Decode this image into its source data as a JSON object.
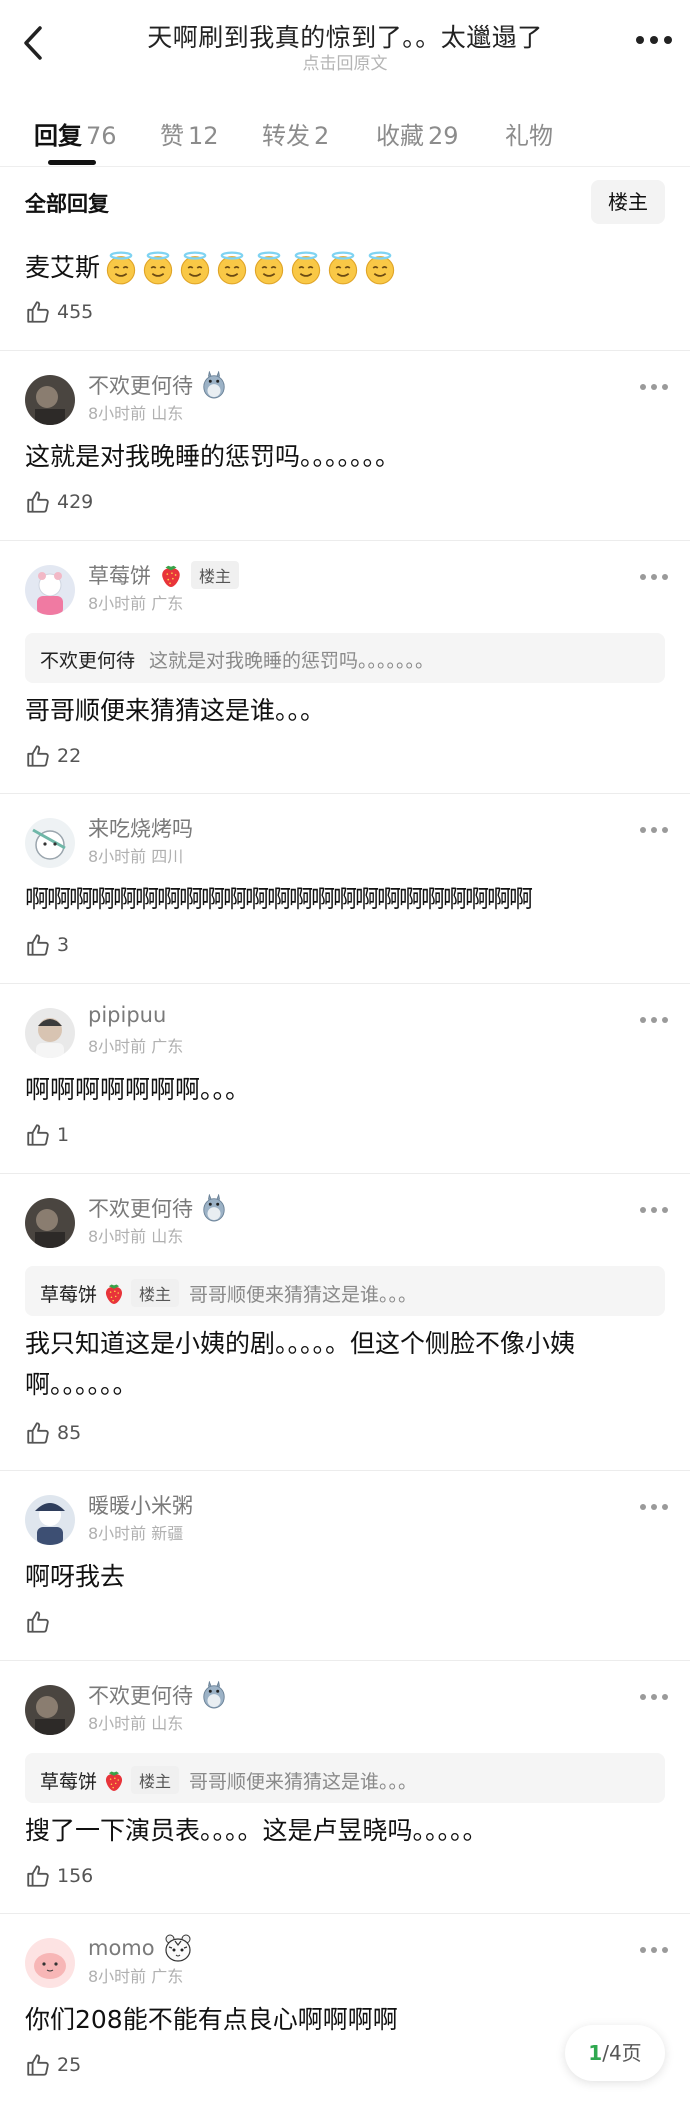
{
  "header": {
    "title": "天啊刷到我真的惊到了。。太邋遢了",
    "subtitle": "点击回原文"
  },
  "tabs": [
    {
      "label": "回复",
      "count": "76"
    },
    {
      "label": "赞",
      "count": "12"
    },
    {
      "label": "转发",
      "count": "2"
    },
    {
      "label": "收藏",
      "count": "29"
    },
    {
      "label": "礼物",
      "count": ""
    }
  ],
  "filter": {
    "label": "全部回复",
    "button": "楼主"
  },
  "top_comment": {
    "text": "麦艾斯",
    "emoji_count": 8,
    "likes": "455"
  },
  "comments": [
    {
      "name": "不欢更何待",
      "meta": "8小时前 山东",
      "text": "这就是对我晚睡的惩罚吗。。。。。。。",
      "likes": "429",
      "icon": "totoro-icon"
    },
    {
      "name": "草莓饼",
      "badge": "楼主",
      "meta": "8小时前 广东",
      "quote_name": "不欢更何待",
      "quote_text": "这就是对我晚睡的惩罚吗。。。。。。。",
      "text": "哥哥顺便来猜猜这是谁。。。",
      "likes": "22",
      "icon": "strawberry-icon"
    },
    {
      "name": "来吃烧烤吗",
      "meta": "8小时前 四川",
      "text": "啊啊啊啊啊啊啊啊啊啊啊啊啊啊啊啊啊啊啊啊啊啊啊",
      "likes": "3"
    },
    {
      "name": "pipipuu",
      "meta": "8小时前 广东",
      "text": "啊啊啊啊啊啊啊。。。",
      "likes": "1"
    },
    {
      "name": "不欢更何待",
      "meta": "8小时前 山东",
      "quote_name": "草莓饼",
      "quote_badge": "楼主",
      "quote_text": "哥哥顺便来猜猜这是谁。。。",
      "text": "我只知道这是小姨的剧。。。。。但这个侧脸不像小姨啊。。。。。。",
      "likes": "85",
      "icon": "totoro-icon"
    },
    {
      "name": "暖暖小米粥",
      "meta": "8小时前 新疆",
      "text": "啊呀我去",
      "likes": ""
    },
    {
      "name": "不欢更何待",
      "meta": "8小时前 山东",
      "quote_name": "草莓饼",
      "quote_badge": "楼主",
      "quote_text": "哥哥顺便来猜猜这是谁。。。",
      "text": "搜了一下演员表。。。。这是卢昱晓吗。。。。。",
      "likes": "156",
      "icon": "totoro-icon"
    },
    {
      "name": "momo",
      "meta": "8小时前 广东",
      "text": "你们208能不能有点良心啊啊啊啊",
      "likes": "25",
      "icon": "tiger-icon"
    }
  ],
  "pager": {
    "current": "1",
    "total": "/4页"
  }
}
